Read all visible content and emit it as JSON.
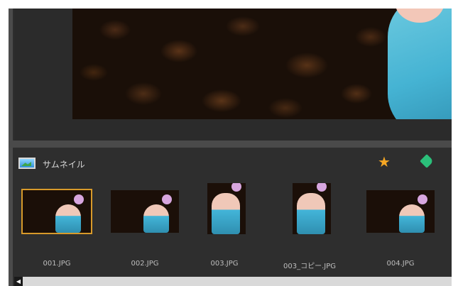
{
  "thumbnail_panel": {
    "title": "サムネイル",
    "icons": {
      "panel": "image-icon",
      "favorite": "star-icon",
      "tag": "tag-icon"
    },
    "accent_color": "#d89a2a",
    "items": [
      {
        "filename": "001.JPG",
        "orientation": "landscape",
        "selected": true
      },
      {
        "filename": "002.JPG",
        "orientation": "landscape",
        "selected": false
      },
      {
        "filename": "003.JPG",
        "orientation": "portrait",
        "selected": false
      },
      {
        "filename": "003_コピー.JPG",
        "orientation": "portrait",
        "selected": false
      },
      {
        "filename": "004.JPG",
        "orientation": "landscape",
        "selected": false
      }
    ]
  },
  "scrollbar": {
    "left_arrow_icon": "arrow-left-icon"
  }
}
